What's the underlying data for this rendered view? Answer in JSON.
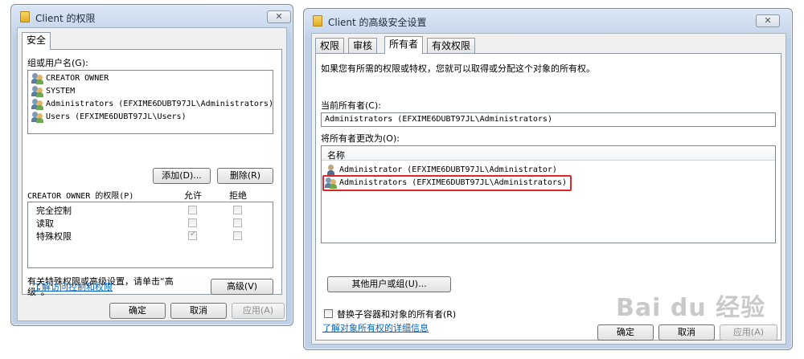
{
  "left_window": {
    "title": "Client 的权限",
    "close_glyph": "✕",
    "tab": "安全",
    "groups_label": "组或用户名(G):",
    "groups": [
      "CREATOR OWNER",
      "SYSTEM",
      "Administrators (EFXIME6DUBT97JL\\Administrators)",
      "Users (EFXIME6DUBT97JL\\Users)"
    ],
    "add_button": "添加(D)...",
    "remove_button": "删除(R)",
    "permissions_label": "CREATOR OWNER 的权限(P)",
    "allow_header": "允许",
    "deny_header": "拒绝",
    "permissions": [
      {
        "name": "完全控制",
        "allow": false,
        "deny": false
      },
      {
        "name": "读取",
        "allow": false,
        "deny": false
      },
      {
        "name": "特殊权限",
        "allow": true,
        "deny": false
      }
    ],
    "special_note": "有关特殊权限或高级设置，请单击“高级”。",
    "advanced_button": "高级(V)",
    "learn_link": "了解访问控制和权限",
    "ok_button": "确定",
    "cancel_button": "取消",
    "apply_button": "应用(A)"
  },
  "right_window": {
    "title": "Client 的高级安全设置",
    "close_glyph": "✕",
    "tabs": [
      "权限",
      "审核",
      "所有者",
      "有效权限"
    ],
    "active_tab": "所有者",
    "description": "如果您有所需的权限或特权，您就可以取得或分配这个对象的所有权。",
    "current_owner_label": "当前所有者(C):",
    "current_owner_value": "Administrators (EFXIME6DUBT97JL\\Administrators)",
    "change_owner_label": "将所有者更改为(O):",
    "name_column": "名称",
    "owners": [
      "Administrator (EFXIME6DUBT97JL\\Administrator)",
      "Administrators (EFXIME6DUBT97JL\\Administrators)"
    ],
    "highlight_color": "#e0262a",
    "other_users_button": "其他用户或组(U)...",
    "replace_checkbox_label": "替换子容器和对象的所有者(R)",
    "details_link": "了解对象所有权的详细信息",
    "ok_button": "确定",
    "cancel_button": "取消",
    "apply_button": "应用(A)"
  },
  "watermark": "Bai du 经验"
}
